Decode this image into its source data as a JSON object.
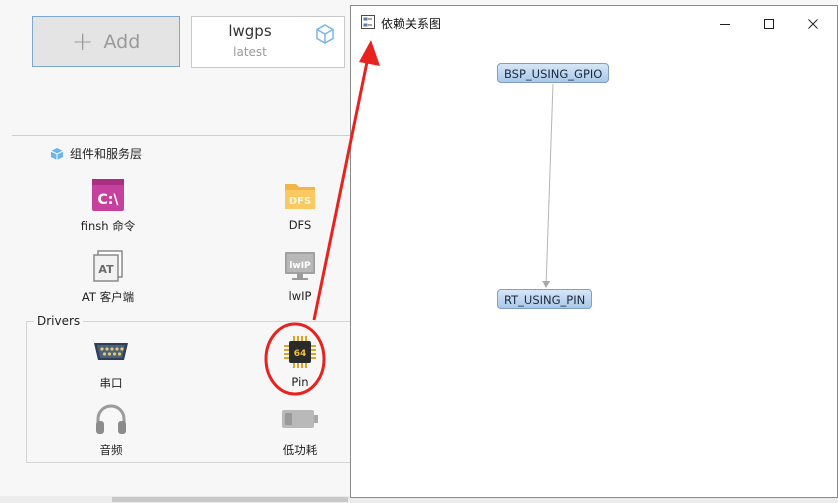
{
  "background_app": {
    "add_button": {
      "label": "Add"
    },
    "package_card": {
      "name": "lwgps",
      "version": "latest"
    },
    "section_title": "组件和服务层",
    "components": [
      {
        "label": "finsh 命令",
        "icon": "terminal-icon"
      },
      {
        "label": "DFS",
        "icon": "folder-icon"
      },
      {
        "label": "AT 客户端",
        "icon": "at-client-icon"
      },
      {
        "label": "lwIP",
        "icon": "network-monitor-icon"
      }
    ],
    "drivers_title": "Drivers",
    "drivers": [
      {
        "label": "串口",
        "icon": "serial-port-icon"
      },
      {
        "label": "Pin",
        "icon": "chip-icon",
        "chip_text": "64"
      },
      {
        "label": "音频",
        "icon": "headphones-icon"
      },
      {
        "label": "低功耗",
        "icon": "battery-icon"
      }
    ]
  },
  "dependency_window": {
    "title": "依赖关系图",
    "controls": [
      "minimize",
      "maximize",
      "close"
    ],
    "nodes": [
      {
        "id": "bsp",
        "label": "BSP_USING_GPIO"
      },
      {
        "id": "rt",
        "label": "RT_USING_PIN"
      }
    ],
    "edges": [
      {
        "from": "bsp",
        "to": "rt"
      }
    ]
  },
  "annotation": {
    "color": "#e8231f"
  }
}
